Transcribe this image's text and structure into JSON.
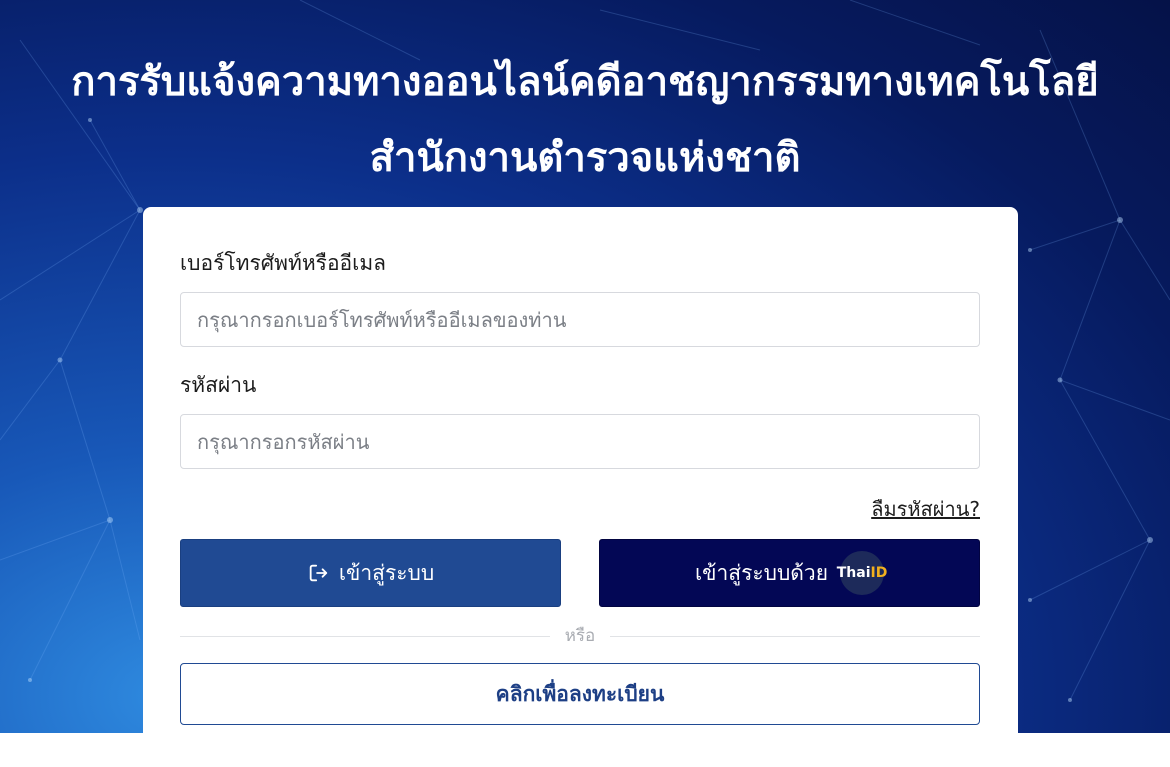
{
  "header": {
    "title_line1": "การรับแจ้งความทางออนไลน์คดีอาชญากรรมทางเทคโนโลยี",
    "title_line2": "สำนักงานตำรวจแห่งชาติ"
  },
  "login_form": {
    "username_label": "เบอร์โทรศัพท์หรืออีเมล",
    "username_placeholder": "กรุณากรอกเบอร์โทรศัพท์หรืออีเมลของท่าน",
    "username_value": "",
    "password_label": "รหัสผ่าน",
    "password_placeholder": "กรุณากรอกรหัสผ่าน",
    "password_value": "",
    "forgot_password": "ลืมรหัสผ่าน?",
    "login_button": "เข้าสู่ระบบ",
    "thaid_button": "เข้าสู่ระบบด้วย",
    "thaid_logo_thai": "Thai",
    "thaid_logo_id": "ID",
    "divider_text": "หรือ",
    "register_button": "คลิกเพื่อลงทะเบียน"
  },
  "icons": {
    "login_icon": "sign-in-icon",
    "thaid_icon": "thaid-logo"
  },
  "colors": {
    "login_button_bg": "#204a93",
    "thaid_button_bg": "#030755",
    "register_text": "#1d3f85",
    "background_dark": "#061a5e",
    "background_light": "#2f8be0"
  }
}
